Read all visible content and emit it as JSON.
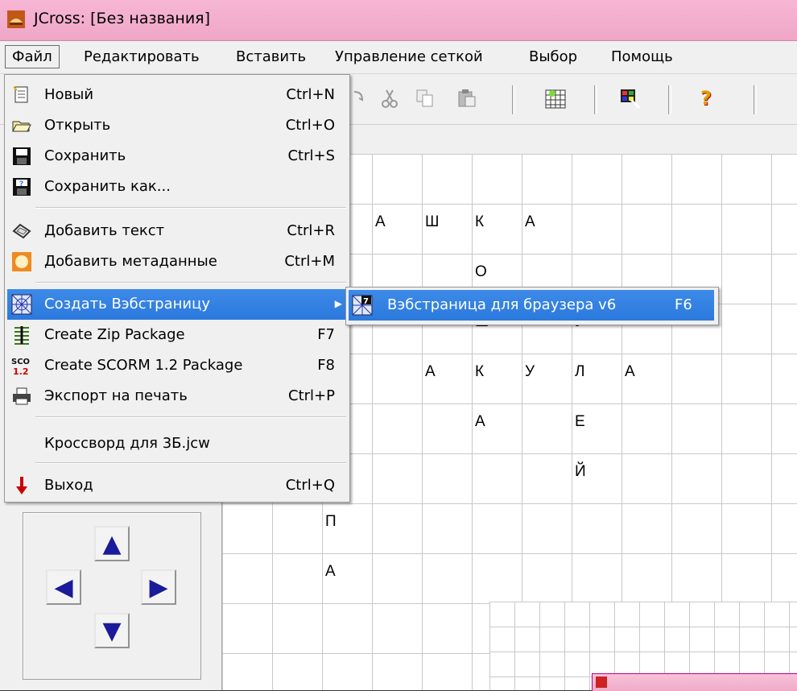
{
  "window": {
    "title": "JCross: [Без названия]"
  },
  "menubar": [
    "Файл",
    "Редактировать",
    "Вставить",
    "Управление сеткой",
    "Выбор",
    "Помощь"
  ],
  "file_menu": {
    "items": [
      {
        "label": "Новый",
        "shortcut": "Ctrl+N",
        "icon": "new-file-icon"
      },
      {
        "label": "Открыть",
        "shortcut": "Ctrl+O",
        "icon": "open-folder-icon"
      },
      {
        "label": "Сохранить",
        "shortcut": "Ctrl+S",
        "icon": "floppy-disk-icon"
      },
      {
        "label": "Сохранить как...",
        "shortcut": "",
        "icon": "save-as-icon"
      },
      {
        "label": "Добавить текст",
        "shortcut": "Ctrl+R",
        "icon": "add-text-icon"
      },
      {
        "label": "Добавить метаданные",
        "shortcut": "Ctrl+M",
        "icon": "metadata-icon"
      },
      {
        "label": "Создать Вэбстраницу",
        "shortcut": "",
        "icon": "web-page-icon"
      },
      {
        "label": "Create Zip Package",
        "shortcut": "F7",
        "icon": "zip-icon"
      },
      {
        "label": "Create SCORM 1.2 Package",
        "shortcut": "F8",
        "icon": "scorm-icon"
      },
      {
        "label": "Экспорт на печать",
        "shortcut": "Ctrl+P",
        "icon": "printer-icon"
      },
      {
        "label": "Кроссворд для 3Б.jcw",
        "shortcut": "",
        "icon": ""
      },
      {
        "label": "Выход",
        "shortcut": "Ctrl+Q",
        "icon": "exit-arrow-icon"
      }
    ],
    "submenu_arrow": "▶"
  },
  "submenu": {
    "label": "Вэбстраница для браузера v6",
    "shortcut": "F6"
  },
  "grid_letters": [
    {
      "t": "А"
    },
    {
      "t": "Ш"
    },
    {
      "t": "К"
    },
    {
      "t": "А"
    },
    {
      "t": "О"
    },
    {
      "t": "Ш"
    },
    {
      "t": "У"
    },
    {
      "t": "А"
    },
    {
      "t": "К"
    },
    {
      "t": "У"
    },
    {
      "t": "Л"
    },
    {
      "t": "А"
    },
    {
      "t": "А"
    },
    {
      "t": "Е"
    },
    {
      "t": "Й"
    },
    {
      "t": "П"
    },
    {
      "t": "А"
    }
  ],
  "nav": {
    "up": "▲",
    "down": "▼",
    "left": "◀",
    "right": "▶"
  },
  "colors": {
    "titlebar": "#f0a6c7",
    "highlight": "#2b79dd",
    "arrow_blue": "#1a1a9a",
    "arrow_red": "#cc0000"
  }
}
